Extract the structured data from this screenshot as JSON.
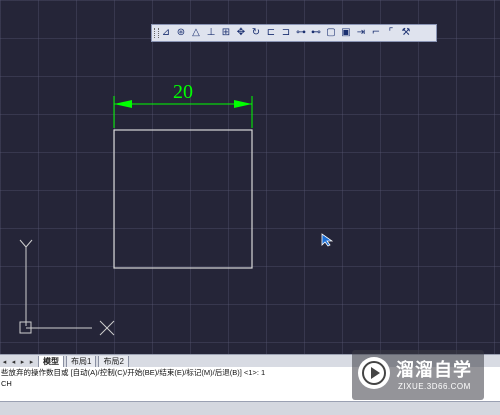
{
  "toolbar": {
    "icons": [
      "dimension-linear-icon",
      "radius-icon",
      "angular-icon",
      "ordinate-icon",
      "grid-icon",
      "move-icon",
      "rotate-icon",
      "baseline-icon",
      "continue-icon",
      "tolerance-icon",
      "break-icon",
      "box-icon",
      "copy-icon",
      "jog-icon",
      "leader-icon",
      "arc-leader-icon",
      "magic-icon"
    ],
    "glyphs": [
      "⊿",
      "⊛",
      "△",
      "⊥",
      "⊞",
      "✥",
      "↻",
      "⊏",
      "⊐",
      "⊶",
      "⊷",
      "▢",
      "▣",
      "⇥",
      "⌐",
      "⌜",
      "⚒"
    ]
  },
  "drawing": {
    "dimension_value": "20",
    "dimension_color": "#00ff00",
    "square_color": "#d8d8d8"
  },
  "ucs": {
    "y_label": "Y",
    "x_label": "X"
  },
  "layout_tabs": {
    "nav": [
      "◂",
      "◂",
      "▸",
      "▸"
    ],
    "tabs": [
      "模型",
      "布局1",
      "布局2"
    ],
    "active": "模型"
  },
  "command_line": {
    "line1": "些放弃的操作数目或 [自动(A)/控制(C)/开始(BE)/结束(E)/标记(M)/后退(B)] <1>: 1",
    "line2": "CH"
  },
  "watermark": {
    "name": "溜溜自学",
    "url": "ZIXUE.3D66.COM"
  },
  "colors": {
    "canvas_bg": "#252538",
    "grid": "#3a3a55",
    "ucs": "#cfcfcf"
  }
}
